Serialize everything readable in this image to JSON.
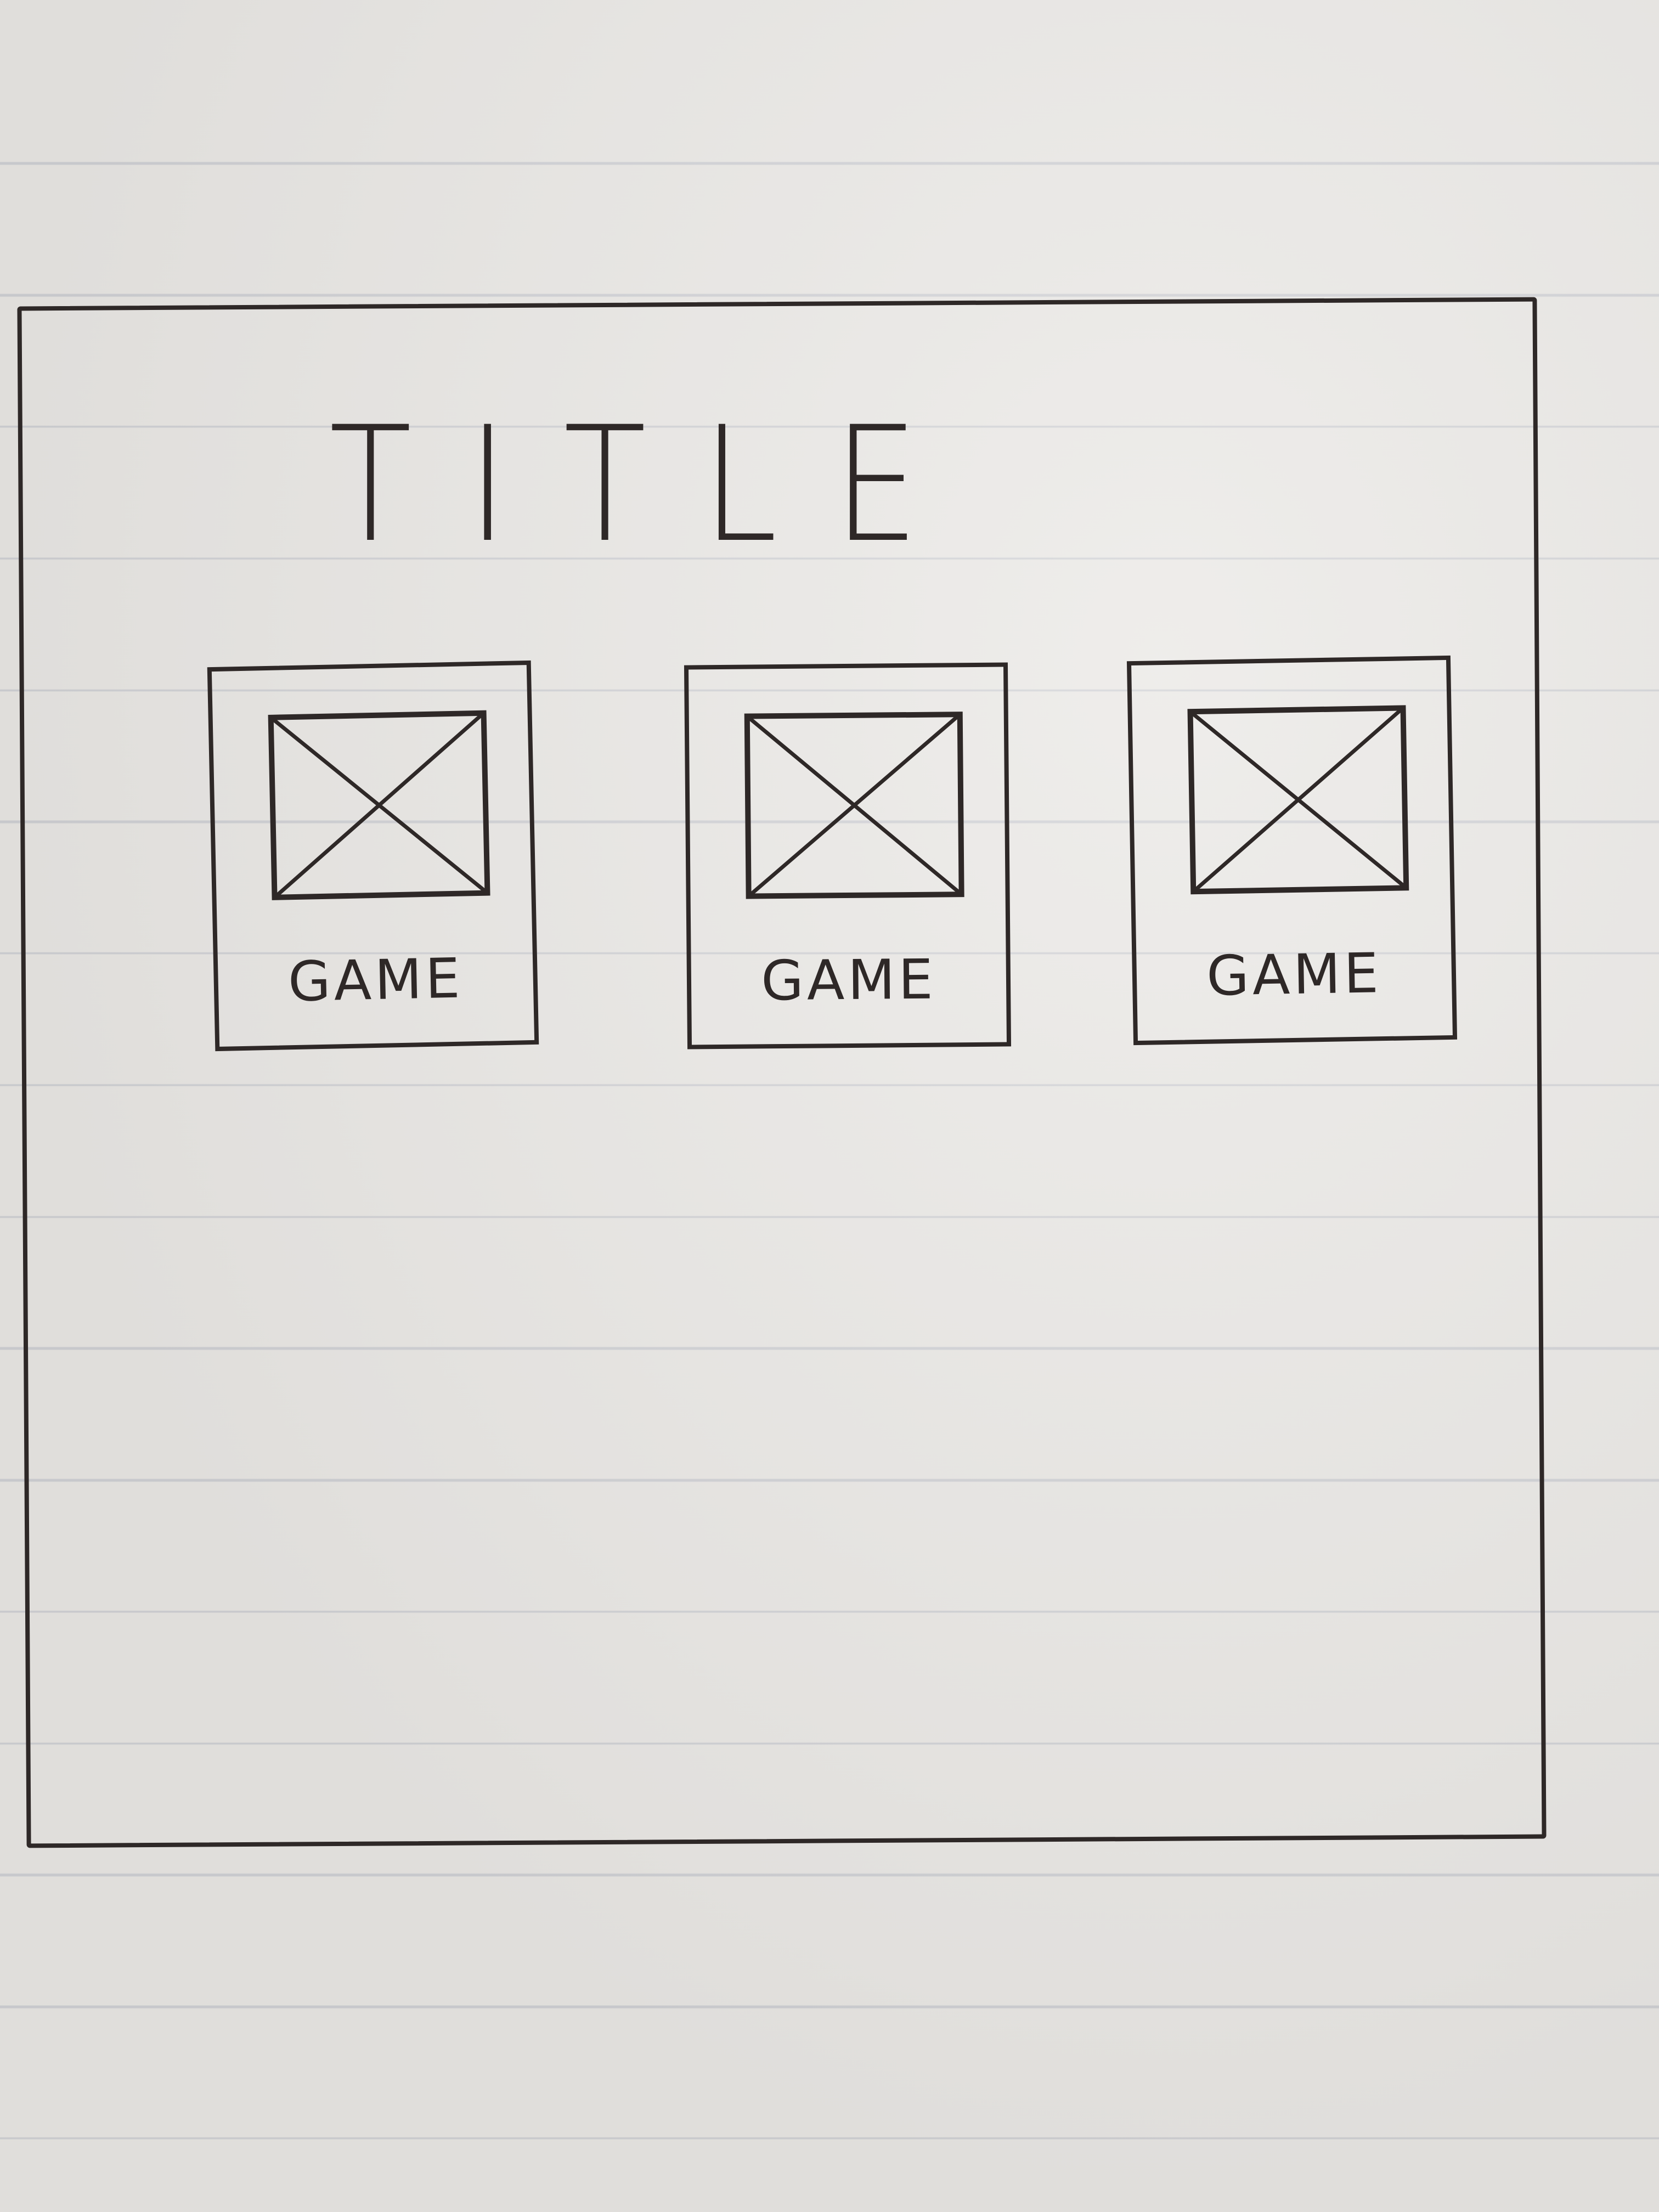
{
  "page": {
    "title": "TITLE"
  },
  "games": [
    {
      "label": "GAME",
      "image_icon": "image-placeholder-icon"
    },
    {
      "label": "GAME",
      "image_icon": "image-placeholder-icon"
    },
    {
      "label": "GAME",
      "image_icon": "image-placeholder-icon"
    }
  ],
  "colors": {
    "paper": "#e9e7e4",
    "rule_line": "#cfd0d4",
    "ink": "#2e2827"
  }
}
